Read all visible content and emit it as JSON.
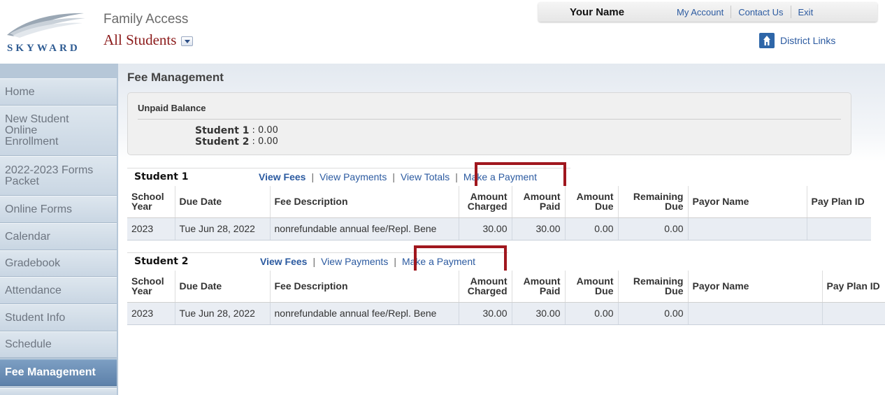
{
  "header": {
    "logo_text": "SKYWARD",
    "app_title": "Family Access",
    "student_selector": "All Students",
    "user_name": "Your Name",
    "top_links": [
      "My Account",
      "Contact Us",
      "Exit"
    ],
    "district_links": "District Links"
  },
  "sidebar": {
    "items": [
      {
        "label": "Home",
        "active": false
      },
      {
        "label": "New Student Online Enrollment",
        "active": false
      },
      {
        "label": "2022-2023 Forms Packet",
        "active": false
      },
      {
        "label": "Online Forms",
        "active": false
      },
      {
        "label": "Calendar",
        "active": false
      },
      {
        "label": "Gradebook",
        "active": false
      },
      {
        "label": "Attendance",
        "active": false
      },
      {
        "label": "Student Info",
        "active": false
      },
      {
        "label": "Schedule",
        "active": false
      },
      {
        "label": "Fee Management",
        "active": true
      }
    ]
  },
  "page": {
    "title": "Fee Management",
    "unpaid_balance": {
      "title": "Unpaid Balance",
      "rows": [
        {
          "student": "Student 1",
          "sep": ":",
          "amount": "0.00"
        },
        {
          "student": "Student 2",
          "sep": ":",
          "amount": "0.00"
        }
      ]
    }
  },
  "table_columns": [
    "School Year",
    "Due Date",
    "Fee Description",
    "Amount Charged",
    "Amount Paid",
    "Amount Due",
    "Remaining Due",
    "Payor Name",
    "Pay Plan ID"
  ],
  "students": [
    {
      "name": "Student 1",
      "links": [
        "View Fees",
        "View Payments",
        "View Totals",
        "Make a Payment"
      ],
      "rows": [
        {
          "school_year": "2023",
          "due_date": "Tue Jun 28, 2022",
          "description": "nonrefundable annual fee/Repl. Bene",
          "charged": "30.00",
          "paid": "30.00",
          "due": "0.00",
          "remaining": "0.00",
          "payor": "",
          "plan": ""
        }
      ]
    },
    {
      "name": "Student 2",
      "links": [
        "View Fees",
        "View Payments",
        "Make a Payment"
      ],
      "rows": [
        {
          "school_year": "2023",
          "due_date": "Tue Jun 28, 2022",
          "description": "nonrefundable annual fee/Repl. Bene",
          "charged": "30.00",
          "paid": "30.00",
          "due": "0.00",
          "remaining": "0.00",
          "payor": "",
          "plan": ""
        }
      ]
    }
  ],
  "colors": {
    "highlight": "#a0171e",
    "link": "#2b5aa0",
    "active_nav": "#6a8eb7",
    "student_select": "#8b1a1a"
  }
}
